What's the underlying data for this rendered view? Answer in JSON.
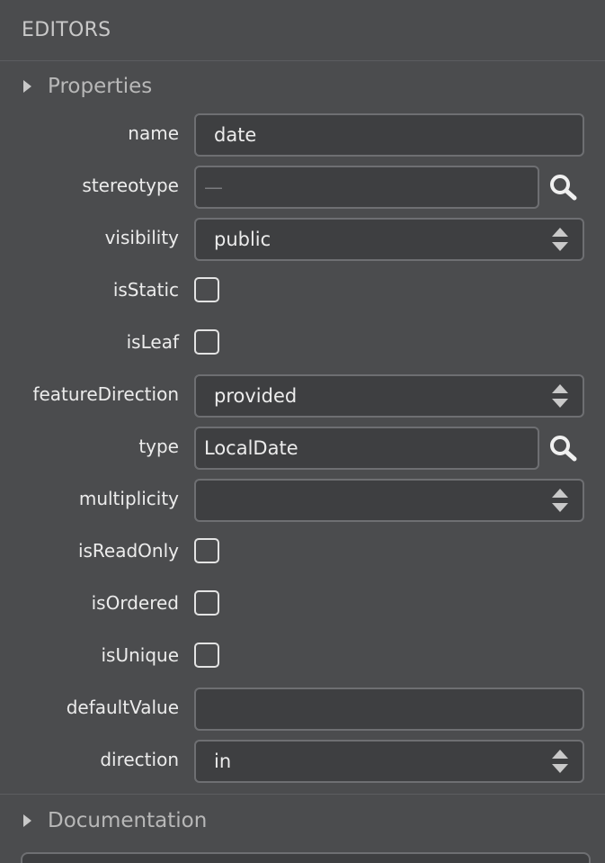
{
  "header": {
    "title": "EDITORS"
  },
  "properties": {
    "section_label": "Properties",
    "name": {
      "label": "name",
      "value": "date"
    },
    "stereotype": {
      "label": "stereotype",
      "placeholder": "—"
    },
    "visibility": {
      "label": "visibility",
      "value": "public"
    },
    "isStatic": {
      "label": "isStatic",
      "checked": false
    },
    "isLeaf": {
      "label": "isLeaf",
      "checked": false
    },
    "featureDirection": {
      "label": "featureDirection",
      "value": "provided"
    },
    "type": {
      "label": "type",
      "value": "LocalDate"
    },
    "multiplicity": {
      "label": "multiplicity",
      "value": ""
    },
    "isReadOnly": {
      "label": "isReadOnly",
      "checked": false
    },
    "isOrdered": {
      "label": "isOrdered",
      "checked": false
    },
    "isUnique": {
      "label": "isUnique",
      "checked": false
    },
    "defaultValue": {
      "label": "defaultValue",
      "value": ""
    },
    "direction": {
      "label": "direction",
      "value": "in"
    }
  },
  "documentation": {
    "section_label": "Documentation"
  },
  "icons": {
    "search": "search-icon",
    "expand": "triangle-right-icon",
    "spinner": "up-down-arrows-icon"
  },
  "colors": {
    "background": "#4b4c4e",
    "field_background": "#3e3f41",
    "field_border": "#6e6f72",
    "text": "#ececec",
    "muted_text": "#b8b8b8"
  }
}
